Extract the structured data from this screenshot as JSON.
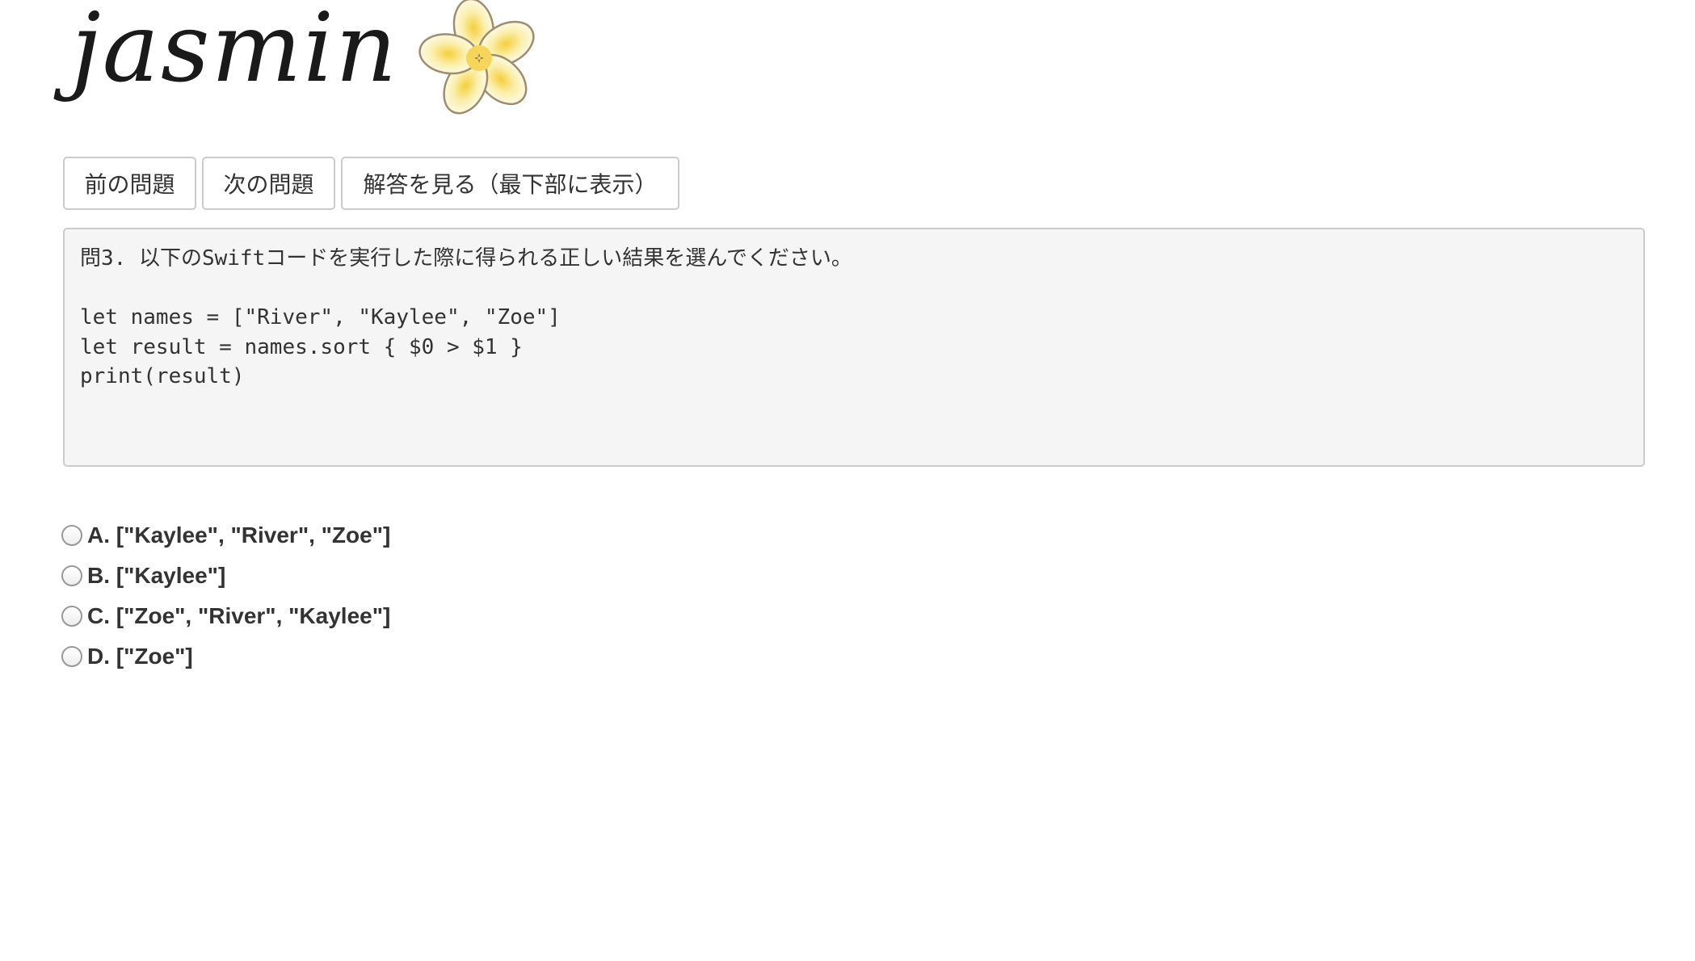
{
  "logo": {
    "text": "jasmin",
    "icon": "plumeria-flower-icon"
  },
  "nav": {
    "prev_label": "前の問題",
    "next_label": "次の問題",
    "answer_label": "解答を見る（最下部に表示）"
  },
  "question": {
    "prompt": "問3. 以下のSwiftコードを実行した際に得られる正しい結果を選んでください。",
    "code": [
      "let names = [\"River\", \"Kaylee\", \"Zoe\"]",
      "let result = names.sort { $0 > $1 }",
      "print(result)"
    ]
  },
  "choices": [
    {
      "label": "A. [\"Kaylee\", \"River\", \"Zoe\"]",
      "selected": false
    },
    {
      "label": "B. [\"Kaylee\"]",
      "selected": false
    },
    {
      "label": "C. [\"Zoe\", \"River\", \"Kaylee\"]",
      "selected": false
    },
    {
      "label": "D. [\"Zoe\"]",
      "selected": false
    }
  ],
  "colors": {
    "flower_center": "#f6d65a",
    "flower_outline": "#a08c6e",
    "panel_bg": "#f5f5f5",
    "border": "#cccccc"
  }
}
